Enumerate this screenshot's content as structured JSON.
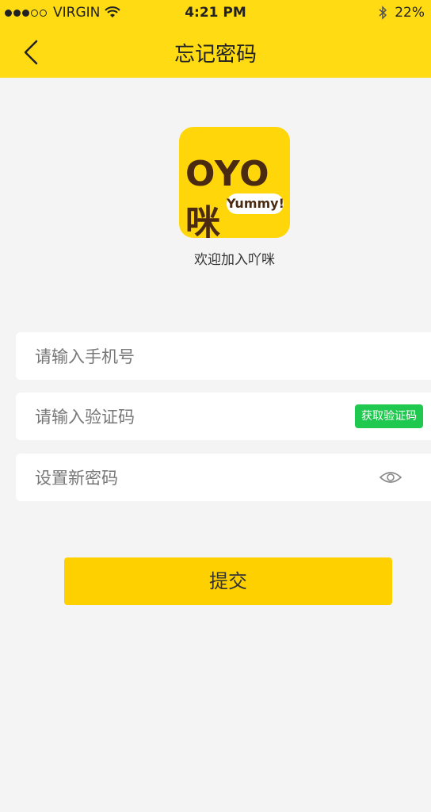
{
  "status_bar": {
    "carrier": "VIRGIN",
    "time": "4:21 PM",
    "battery": "22%",
    "signal_icon": "signal-dots-icon",
    "wifi_icon": "wifi-icon",
    "bluetooth_icon": "bluetooth-icon"
  },
  "nav": {
    "title": "忘记密码",
    "back_icon": "chevron-left-icon"
  },
  "logo": {
    "text": "OYO咪",
    "bubble": "Yummy!"
  },
  "welcome": "欢迎加入吖咪",
  "form": {
    "phone_placeholder": "请输入手机号",
    "code_placeholder": "请输入验证码",
    "get_code_label": "获取验证码",
    "password_placeholder": "设置新密码",
    "eye_icon": "eye-icon"
  },
  "submit_label": "提交",
  "colors": {
    "header": "#ffdb14",
    "accent_green": "#1fc84e",
    "submit": "#ffd000",
    "background": "#f4f4f4"
  }
}
